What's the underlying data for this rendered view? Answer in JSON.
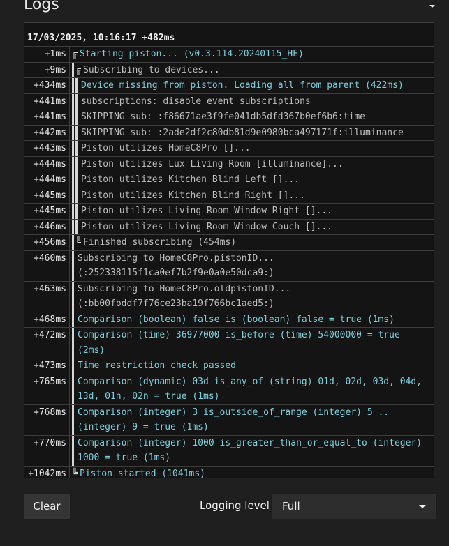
{
  "header": {
    "title": "Logs"
  },
  "log": {
    "heading": "17/03/2025, 10:16:17 +482ms",
    "entries": [
      {
        "ts": "+1ms",
        "depth": 0,
        "glyph": "╔",
        "color": "cyan",
        "text": "Starting piston... (v0.3.114.20240115_HE)"
      },
      {
        "ts": "+9ms",
        "depth": 1,
        "glyph": "╔",
        "color": "gray",
        "text": "Subscribing to devices..."
      },
      {
        "ts": "+434ms",
        "depth": 2,
        "glyph": "",
        "color": "cyan",
        "text": "Device missing from piston. Loading all from parent (422ms)"
      },
      {
        "ts": "+441ms",
        "depth": 2,
        "glyph": "",
        "color": "gray",
        "text": "subscriptions: disable event subscriptions"
      },
      {
        "ts": "+441ms",
        "depth": 2,
        "glyph": "",
        "color": "gray",
        "text": "SKIPPING sub: :f86671ae3f9fe041db5dfd367b0ef6b6:time"
      },
      {
        "ts": "+442ms",
        "depth": 2,
        "glyph": "",
        "color": "gray",
        "text": "SKIPPING sub: :2ade2df2c80db81d9e0980bca497171f:illuminance"
      },
      {
        "ts": "+443ms",
        "depth": 2,
        "glyph": "",
        "color": "gray",
        "text": "Piston utilizes HomeC8Pro []..."
      },
      {
        "ts": "+444ms",
        "depth": 2,
        "glyph": "",
        "color": "gray",
        "text": "Piston utilizes Lux Living Room [illuminance]..."
      },
      {
        "ts": "+444ms",
        "depth": 2,
        "glyph": "",
        "color": "gray",
        "text": "Piston utilizes Kitchen Blind Left []..."
      },
      {
        "ts": "+445ms",
        "depth": 2,
        "glyph": "",
        "color": "gray",
        "text": "Piston utilizes Kitchen Blind Right []..."
      },
      {
        "ts": "+445ms",
        "depth": 2,
        "glyph": "",
        "color": "gray",
        "text": "Piston utilizes Living Room Window Right []..."
      },
      {
        "ts": "+446ms",
        "depth": 2,
        "glyph": "",
        "color": "gray",
        "text": "Piston utilizes Living Room Window Couch []..."
      },
      {
        "ts": "+456ms",
        "depth": 1,
        "glyph": "╚",
        "color": "gray",
        "text": "Finished subscribing (454ms)"
      },
      {
        "ts": "+460ms",
        "depth": 1,
        "glyph": "",
        "color": "gray",
        "text": "Subscribing to HomeC8Pro.pistonID... (:252338115f1ca0ef7b2f9e0a0e50dca9:)"
      },
      {
        "ts": "+463ms",
        "depth": 1,
        "glyph": "",
        "color": "gray",
        "text": "Subscribing to HomeC8Pro.oldpistonID... (:bb00fbddf7f76ce23ba19f766bc1aed5:)"
      },
      {
        "ts": "+468ms",
        "depth": 1,
        "glyph": "",
        "color": "cyan",
        "text": "Comparison (boolean) false is (boolean) false = true (1ms)"
      },
      {
        "ts": "+472ms",
        "depth": 1,
        "glyph": "",
        "color": "cyan",
        "text": "Comparison (time) 36977000 is_before (time) 54000000 = true (2ms)"
      },
      {
        "ts": "+473ms",
        "depth": 1,
        "glyph": "",
        "color": "cyan",
        "text": "Time restriction check passed"
      },
      {
        "ts": "+765ms",
        "depth": 1,
        "glyph": "",
        "color": "cyan",
        "text": "Comparison (dynamic) 03d is_any_of (string) 01d, 02d, 03d, 04d, 13d, 01n, 02n = true (1ms)"
      },
      {
        "ts": "+768ms",
        "depth": 1,
        "glyph": "",
        "color": "cyan",
        "text": "Comparison (integer) 3 is_outside_of_range (integer) 5 .. (integer) 9 = true (1ms)"
      },
      {
        "ts": "+770ms",
        "depth": 1,
        "glyph": "",
        "color": "cyan",
        "text": "Comparison (integer) 1000 is_greater_than_or_equal_to (integer) 1000 = true (1ms)"
      },
      {
        "ts": "+1042ms",
        "depth": 0,
        "glyph": "╚",
        "color": "cyan",
        "text": "Piston started (1041ms)"
      }
    ]
  },
  "footer": {
    "clear_label": "Clear",
    "level_label": "Logging level",
    "level_value": "Full"
  }
}
